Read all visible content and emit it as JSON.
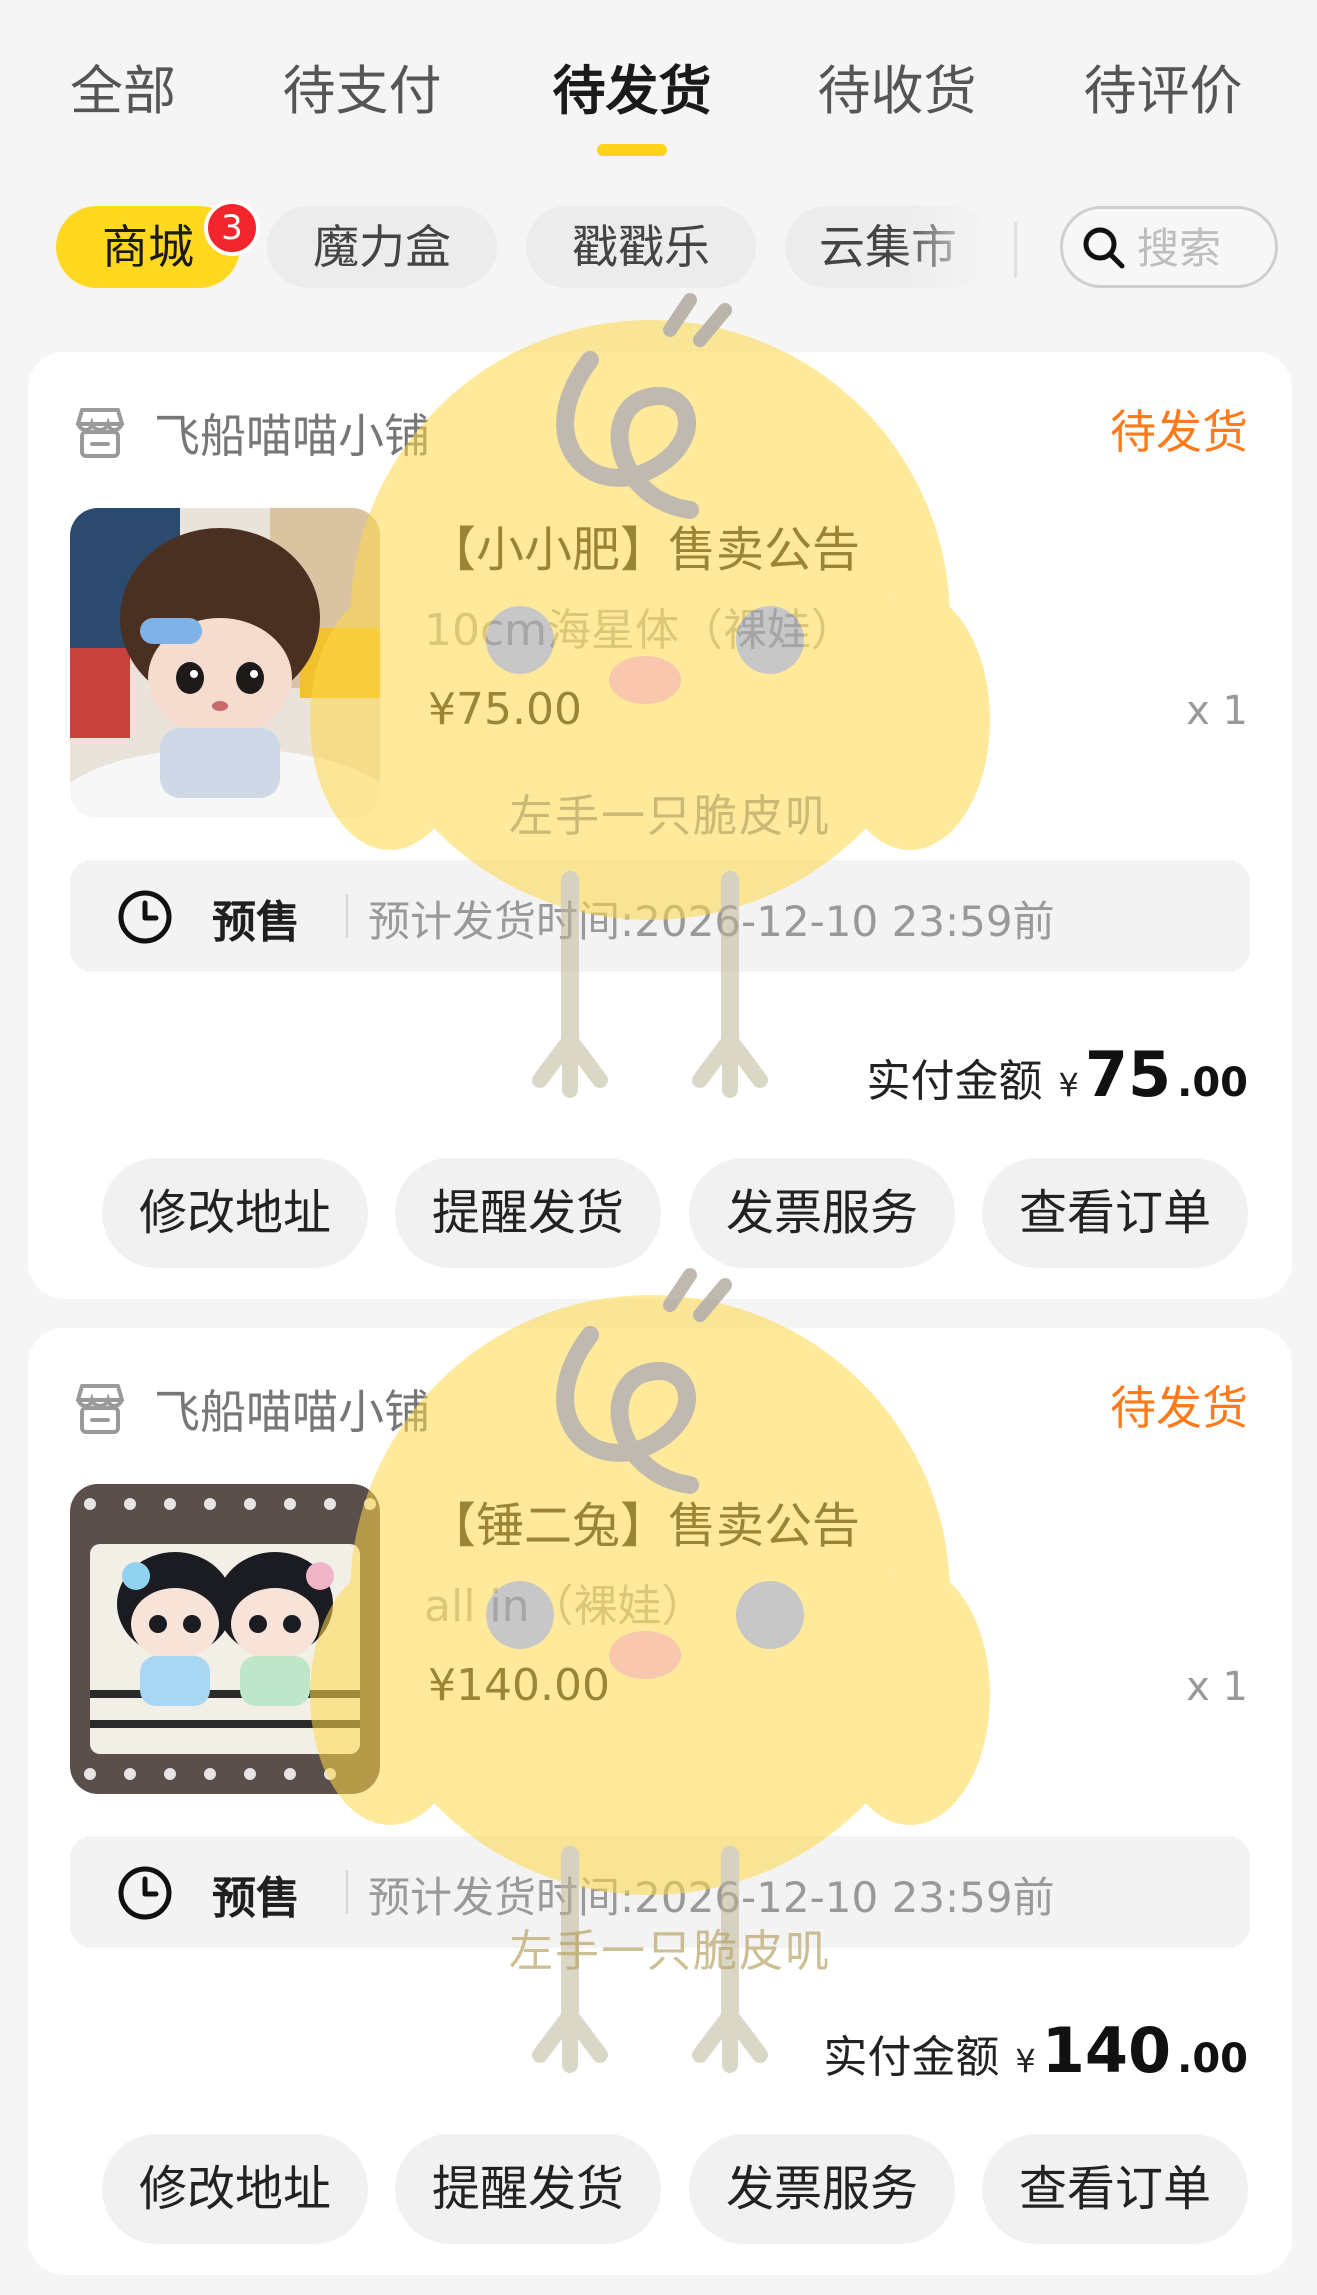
{
  "tabs": [
    {
      "label": "全部"
    },
    {
      "label": "待支付"
    },
    {
      "label": "待发货"
    },
    {
      "label": "待收货"
    },
    {
      "label": "待评价"
    }
  ],
  "active_tab": "待发货",
  "chips": [
    {
      "label": "商城",
      "badge": "3"
    },
    {
      "label": "魔力盒"
    },
    {
      "label": "戳戳乐"
    },
    {
      "label": "云集市"
    }
  ],
  "search": {
    "placeholder": "搜索",
    "icon": "search-icon"
  },
  "orders": [
    {
      "shop_icon": "store-icon",
      "shop_name": "飞船喵喵小铺",
      "status": "待发货",
      "product_title": "【小小肥】售卖公告",
      "product_spec": "10cm海星体（裸娃）",
      "price": "¥75.00",
      "quantity": "x 1",
      "presale_icon": "clock-icon",
      "presale_label": "预售",
      "presale_text": "预计发货时间:2026-12-10 23:59前",
      "total_label": "实付金额",
      "total_currency": "¥",
      "total_int": "75",
      "total_dec": ".00",
      "buttons": [
        "修改地址",
        "提醒发货",
        "发票服务",
        "查看订单"
      ]
    },
    {
      "shop_icon": "store-icon",
      "shop_name": "飞船喵喵小铺",
      "status": "待发货",
      "product_title": "【锤二兔】售卖公告",
      "product_spec": "all in（裸娃）",
      "price": "¥140.00",
      "quantity": "x 1",
      "presale_icon": "clock-icon",
      "presale_label": "预售",
      "presale_text": "预计发货时间:2026-12-10 23:59前",
      "total_label": "实付金额",
      "total_currency": "¥",
      "total_int": "140",
      "total_dec": ".00",
      "buttons": [
        "修改地址",
        "提醒发货",
        "发票服务",
        "查看订单"
      ]
    }
  ],
  "watermark": {
    "text": "左手一只脆皮叽"
  },
  "colors": {
    "accent_yellow": "#ffd81f",
    "status_orange": "#ff7a1c",
    "badge_red": "#f2252c",
    "background": "#f5f5f5"
  }
}
